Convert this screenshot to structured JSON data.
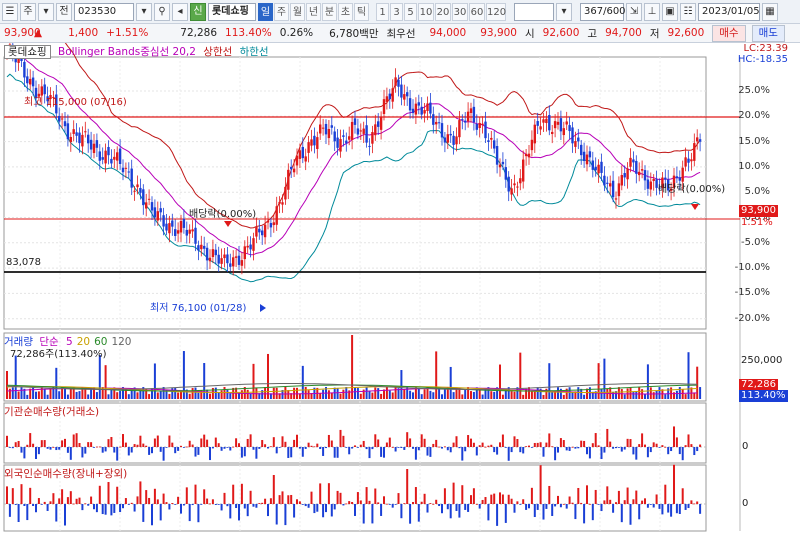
{
  "toolbar": {
    "type_label": "주",
    "mode_label": "전",
    "code": "023530",
    "name_badge": "신",
    "name": "롯데쇼핑",
    "periods": [
      "일",
      "주",
      "월",
      "년",
      "분",
      "초",
      "틱"
    ],
    "active_period": "일",
    "intervals": [
      "1",
      "3",
      "5",
      "10",
      "20",
      "30",
      "60",
      "120"
    ],
    "count": "367/600",
    "date": "2023/01/05"
  },
  "quote": {
    "price": "93,900",
    "change_arrow": "▲",
    "change": "1,400",
    "change_pct": "+1.51%",
    "volume": "72,286",
    "volume_ratio": "113.40%",
    "turnover": "0.26%",
    "amount": "6,780백만",
    "best_ask_label": "최우선",
    "best_ask": "94,000",
    "best_bid": "93,900",
    "open_label": "시",
    "open": "92,600",
    "high_label": "고",
    "high": "94,700",
    "low_label": "저",
    "low": "92,600",
    "buy_label": "매수",
    "sell_label": "매도"
  },
  "price_pane": {
    "stock_label": "롯데쇼핑",
    "indicator_name": "Bollinger Bands중심선 20,2",
    "upper_label": "상한선",
    "lower_label": "하한선",
    "lc": "LC:23.39",
    "hc": "HC:-18.35",
    "high_note": "최고 115,000 (07/16)",
    "low_note": "최저 76,100 (01/28)",
    "div_note_1": "배당락(0.00%)",
    "div_note_2": "배당락(0.00%)",
    "base_price_label": "83,078",
    "current_tag": "93,900",
    "current_pct": "1.51%",
    "pct_ticks": [
      "25.0%",
      "20.0%",
      "15.0%",
      "10.0%",
      "5.0%",
      "0.0%",
      "-5.0%",
      "-10.0%",
      "-15.0%",
      "-20.0%"
    ],
    "colors": {
      "upper": "#c01818",
      "middle": "#b800b8",
      "lower": "#008a9a",
      "up": "#e01919",
      "down": "#1a3fd6"
    }
  },
  "volume_pane": {
    "title": "거래량",
    "ma_label": "단순",
    "ma_periods": [
      "5",
      "20",
      "60",
      "120"
    ],
    "ma_colors": [
      "#b800b8",
      "#c8a000",
      "#2a8a2a",
      "#666666"
    ],
    "current_text": "72,286주(113.40%)",
    "tick_top": "250,000",
    "current_tag": "72,286",
    "pct_tag": "113.40%"
  },
  "inst_pane": {
    "title": "기관순매수량(거래소)",
    "zero_label": "0"
  },
  "foreign_pane": {
    "title": "외국인순매수량(장내+장외)",
    "zero_label": "0"
  },
  "chart_data": [
    {
      "type": "candlestick",
      "title": "롯데쇼핑",
      "price_range": [
        69000,
        104000
      ],
      "percent_range": [
        -20,
        25
      ],
      "high": {
        "value": 115000,
        "date": "07/16"
      },
      "low": {
        "value": 76100,
        "date": "01/28"
      },
      "close_path": [
        106000,
        103500,
        101000,
        99000,
        96000,
        94000,
        93000,
        92000,
        90000,
        88000,
        84000,
        83000,
        82000,
        80500,
        79000,
        77000,
        78500,
        80000,
        82500,
        86000,
        91000,
        94000,
        95000,
        94000,
        95500,
        93500,
        98500,
        101000,
        99000,
        97500,
        95500,
        94000,
        97500,
        96000,
        90500,
        87500,
        91500,
        97000,
        96000,
        94500,
        92500,
        89000,
        87000,
        90500,
        89000,
        88500,
        87000,
        91500,
        93900
      ]
    },
    {
      "type": "bar",
      "title": "거래량",
      "ylim": [
        0,
        320000
      ],
      "latest": 72286
    },
    {
      "type": "bar",
      "title": "기관순매수량(거래소)"
    },
    {
      "type": "bar",
      "title": "외국인순매수량(장내+장외)"
    }
  ]
}
